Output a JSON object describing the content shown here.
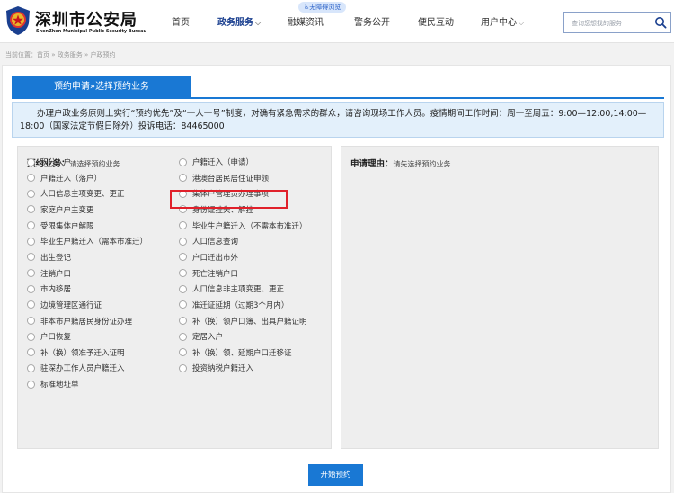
{
  "header": {
    "brand_cn": "深圳市公安局",
    "brand_en": "ShenZhen Municipal Public Security Bureau",
    "accessibility_label": "无障碍浏览",
    "nav": [
      "首页",
      "政务服务",
      "融媒资讯",
      "警务公开",
      "便民互动",
      "用户中心"
    ],
    "active_nav": "政务服务",
    "search_placeholder": "查询您想找的服务"
  },
  "breadcrumb": "当前位置：首页 » 政务服务 » 户政预约",
  "tab_label": "预约申请»选择预约业务",
  "notice": "办理户政业务原则上实行“预约优先”及“一人一号”制度，对确有紧急需求的群众，请咨询现场工作人员。疫情期间工作时间：周一至周五：9:00—12:00,14:00—18:00（国家法定节假日除外）投诉电话：84465000",
  "business_panel": {
    "title": "预约业务：",
    "hint": "请选择预约业务",
    "items": [
      "积分入户",
      "户籍迁入（申请）",
      "户籍迁入（落户）",
      "港澳台居民居住证申领",
      "人口信息主项变更、更正",
      "集体户管理员办理事项",
      "家庭户户主变更",
      "身份证挂失、解挂",
      "受限集体户解限",
      "毕业生户籍迁入（不需本市准迁）",
      "毕业生户籍迁入（需本市准迁）",
      "人口信息查询",
      "出生登记",
      "户口迁出市外",
      "注销户口",
      "死亡注销户口",
      "市内移居",
      "人口信息非主项变更、更正",
      "边境管理区通行证",
      "准迁证延期（过期3个月内）",
      "非本市户籍居民身份证办理",
      "补（换）领户口簿、出具户籍证明",
      "户口恢复",
      "定居入户",
      "补（换）领准予迁入证明",
      "补（换）领、延期户口迁移证",
      "驻深办工作人员户籍迁入",
      "投资纳税户籍迁入",
      "标准地址单"
    ]
  },
  "reason_panel": {
    "title": "申请理由：",
    "hint": "请先选择预约业务"
  },
  "submit_label": "开始预约",
  "colors": {
    "primary": "#1978d4",
    "notice_bg": "#e3f0fb",
    "highlight": "#e0202a",
    "active_nav": "#1a3f8f"
  }
}
